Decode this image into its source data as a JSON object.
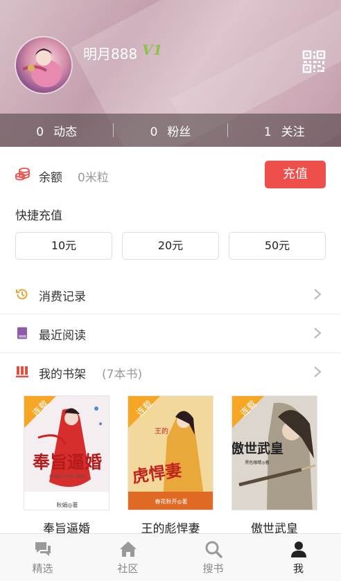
{
  "profile": {
    "username": "明月888",
    "vip_level": "V1"
  },
  "stats": [
    {
      "count": "0",
      "label": "动态"
    },
    {
      "count": "0",
      "label": "粉丝"
    },
    {
      "count": "1",
      "label": "关注"
    }
  ],
  "wallet": {
    "balance_label": "余额",
    "balance_value": "0米粒",
    "recharge_button": "充值",
    "quick_title": "快捷充值",
    "amounts": [
      "10元",
      "20元",
      "50元"
    ]
  },
  "menu": {
    "consumption": "消费记录",
    "recent": "最近阅读",
    "shelf": "我的书架",
    "shelf_count": "(7本书)"
  },
  "books": [
    {
      "title": "奉旨逼婚",
      "badge": "连载",
      "cover_title": "奉旨逼婚",
      "cover_sub": "FENG ZHI BI HUN",
      "author": "秋娟◎著"
    },
    {
      "title": "王的彪悍妻",
      "badge": "连载",
      "cover_title": "虎悍妻",
      "cover_small": "王的",
      "author": "春花秋开◎著"
    },
    {
      "title": "傲世武皇",
      "badge": "连载",
      "cover_title": "傲世武皇",
      "author": "黑色眼睛◎著"
    }
  ],
  "tabs": [
    {
      "label": "精选",
      "icon": "chat-icon"
    },
    {
      "label": "社区",
      "icon": "home-icon"
    },
    {
      "label": "搜书",
      "icon": "search-icon"
    },
    {
      "label": "我",
      "icon": "person-icon"
    }
  ],
  "colors": {
    "accent": "#ee4f4a",
    "vip": "#8bc34a",
    "history_icon": "#f0a030",
    "recent_icon": "#8e5ca8",
    "shelf_icon": "#e84c3d",
    "badge": "#f6a623"
  }
}
